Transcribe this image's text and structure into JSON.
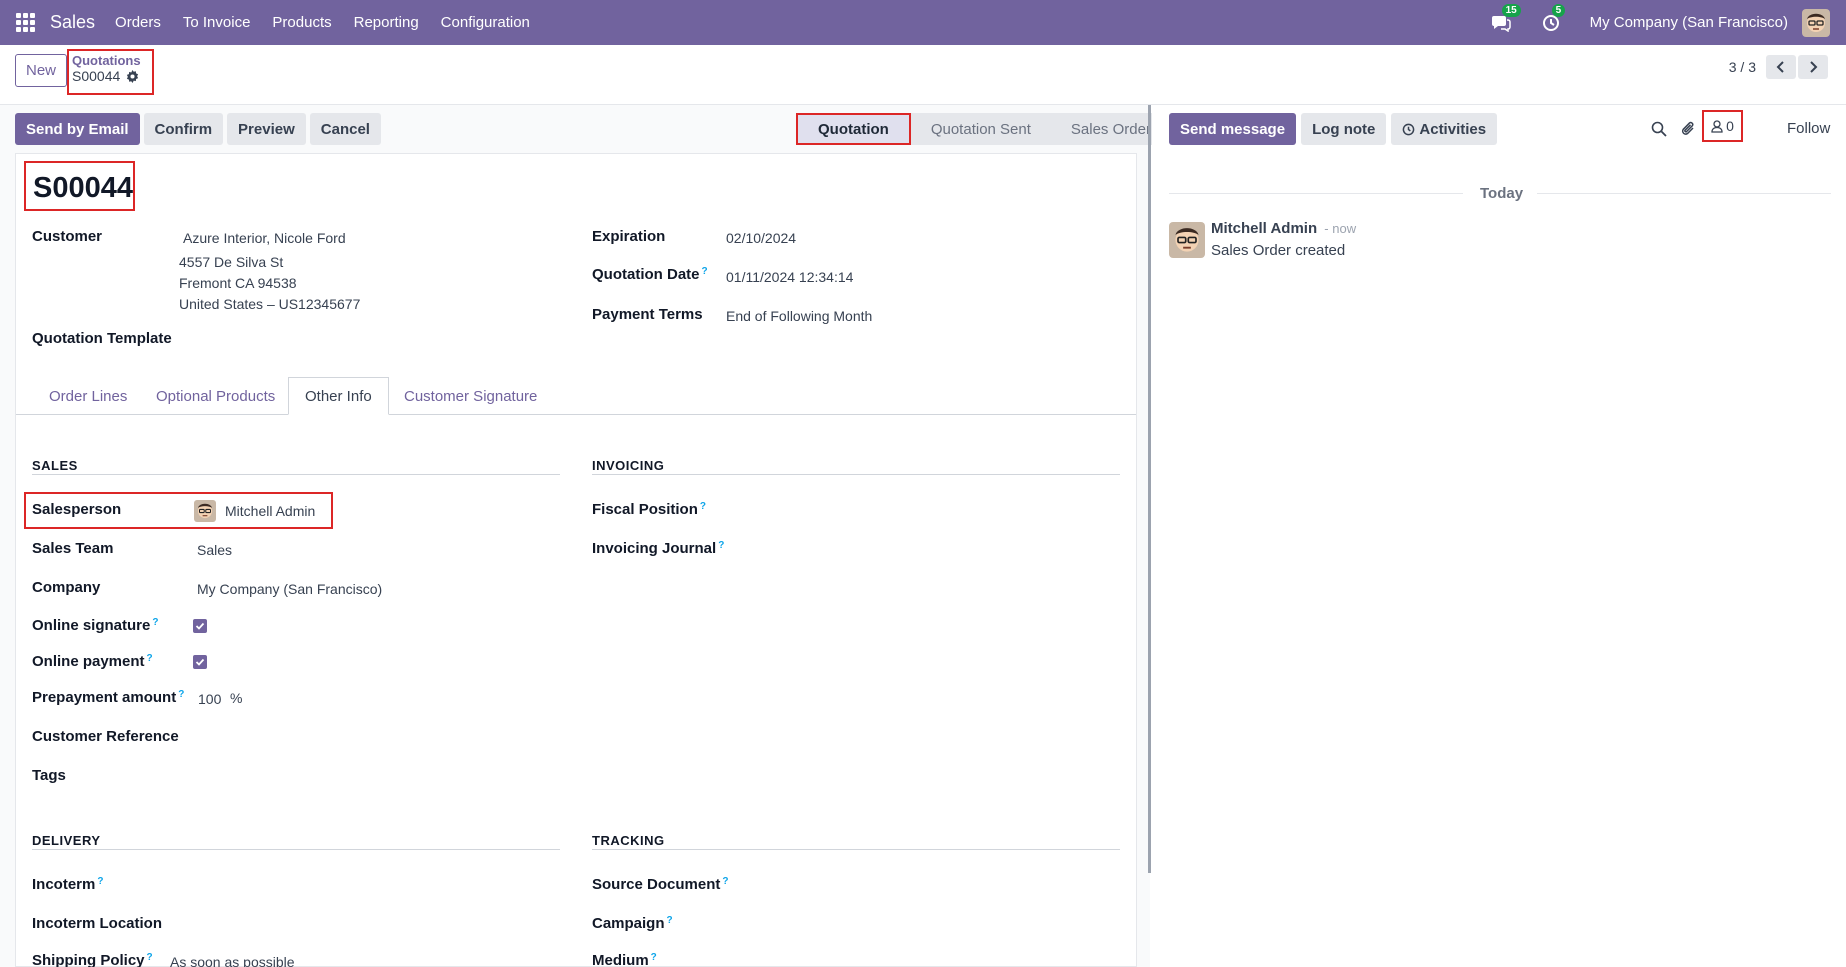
{
  "navbar": {
    "app_name": "Sales",
    "menu": [
      "Orders",
      "To Invoice",
      "Products",
      "Reporting",
      "Configuration"
    ],
    "messages_badge": "15",
    "activities_badge": "5",
    "company": "My Company (San Francisco)",
    "icons": [
      "apps-grid-icon",
      "chat-icon",
      "clock-icon",
      "user-avatar"
    ]
  },
  "control": {
    "new_label": "New",
    "breadcrumb_parent": "Quotations",
    "breadcrumb_current": "S00044",
    "pager": "3 / 3"
  },
  "statusbar": {
    "buttons": [
      "Send by Email",
      "Confirm",
      "Preview",
      "Cancel"
    ],
    "stages": [
      "Quotation",
      "Quotation Sent",
      "Sales Order"
    ],
    "active_stage": "Quotation"
  },
  "form": {
    "name": "S00044",
    "customer_label": "Customer",
    "customer_name": "Azure Interior, Nicole Ford",
    "customer_address": [
      "4557 De Silva St",
      "Fremont CA 94538",
      "United States – US12345677"
    ],
    "quotation_template_label": "Quotation Template",
    "expiration_label": "Expiration",
    "expiration_value": "02/10/2024",
    "quotation_date_label": "Quotation Date",
    "quotation_date_value": "01/11/2024 12:34:14",
    "payment_terms_label": "Payment Terms",
    "payment_terms_value": "End of Following Month"
  },
  "tabs": [
    "Order Lines",
    "Optional Products",
    "Other Info",
    "Customer Signature"
  ],
  "active_tab": "Other Info",
  "other_info": {
    "sales_title": "SALES",
    "salesperson_label": "Salesperson",
    "salesperson_value": "Mitchell Admin",
    "sales_team_label": "Sales Team",
    "sales_team_value": "Sales",
    "company_label": "Company",
    "company_value": "My Company (San Francisco)",
    "online_signature_label": "Online signature",
    "online_signature_checked": true,
    "online_payment_label": "Online payment",
    "online_payment_checked": true,
    "prepayment_label": "Prepayment amount",
    "prepayment_value": "100",
    "prepayment_unit": "%",
    "customer_reference_label": "Customer Reference",
    "tags_label": "Tags",
    "invoicing_title": "INVOICING",
    "fiscal_position_label": "Fiscal Position",
    "invoicing_journal_label": "Invoicing Journal",
    "delivery_title": "DELIVERY",
    "incoterm_label": "Incoterm",
    "incoterm_location_label": "Incoterm Location",
    "shipping_policy_label": "Shipping Policy",
    "shipping_policy_value": "As soon as possible",
    "tracking_title": "TRACKING",
    "source_document_label": "Source Document",
    "campaign_label": "Campaign",
    "medium_label": "Medium"
  },
  "chatter": {
    "send_message": "Send message",
    "log_note": "Log note",
    "activities": "Activities",
    "followers_count": "0",
    "follow": "Follow",
    "today": "Today",
    "message_author": "Mitchell Admin",
    "message_time": "- now",
    "message_body": "Sales Order created"
  },
  "colors": {
    "brand": "#71639e",
    "highlight": "#dc2626",
    "badge": "#16a34a"
  }
}
